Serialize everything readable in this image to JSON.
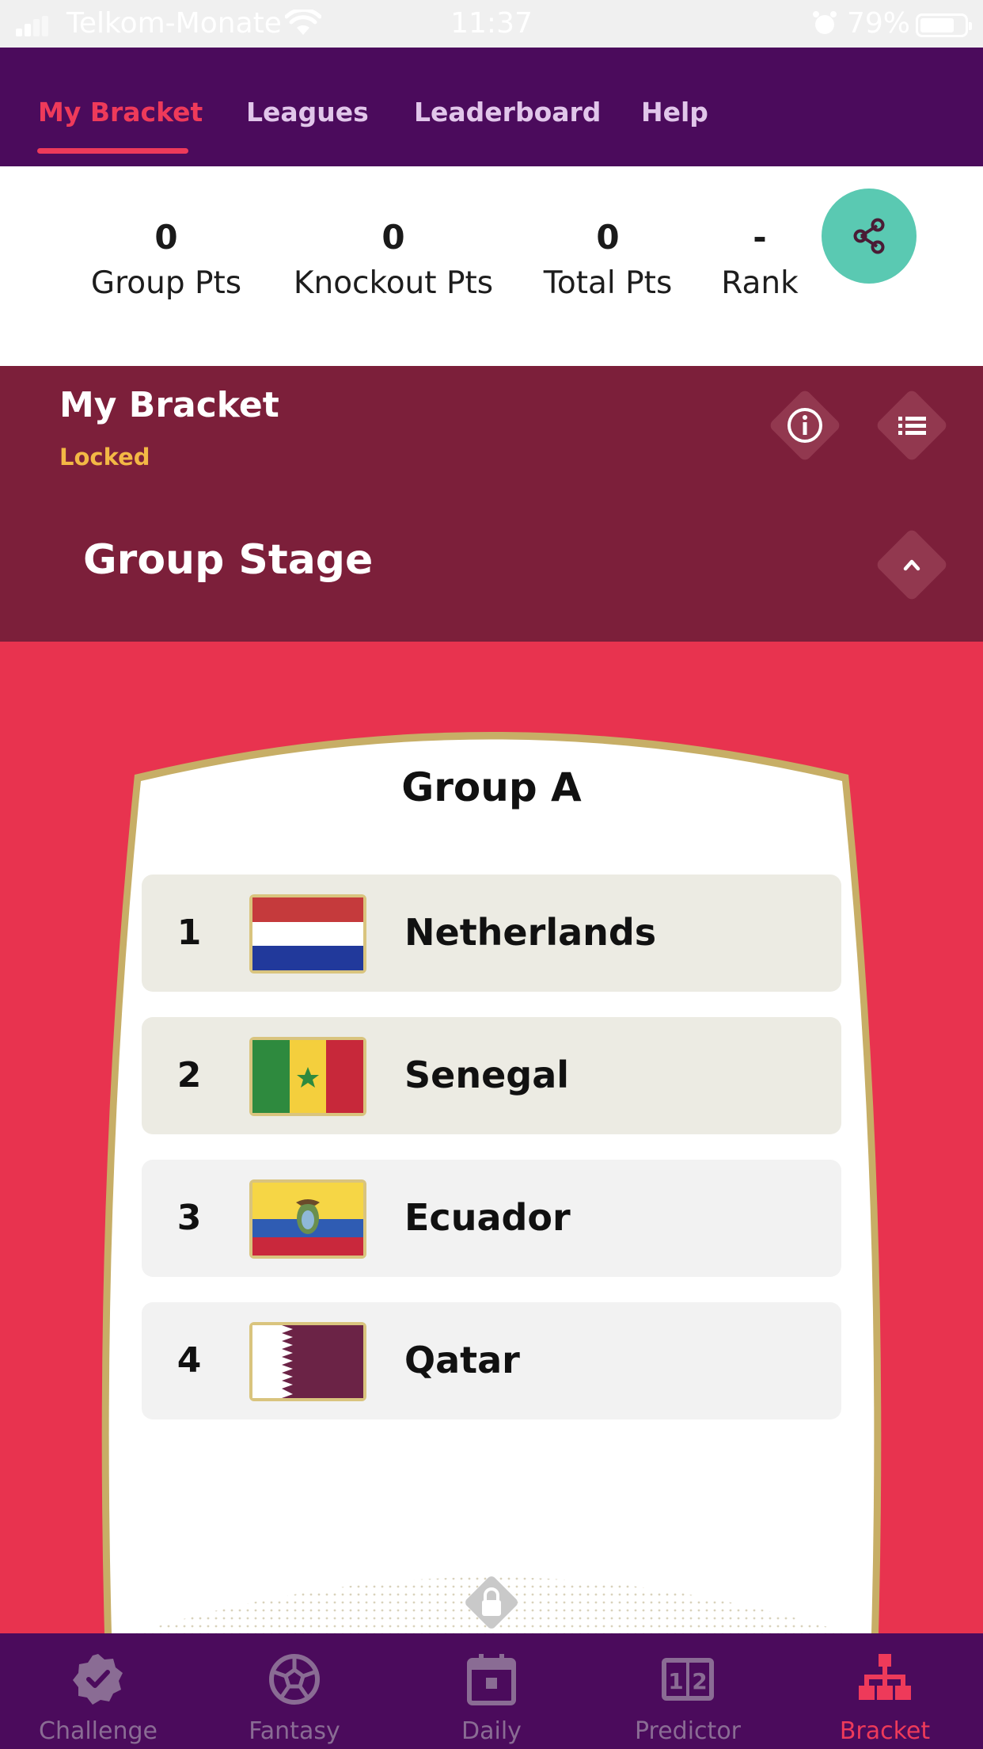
{
  "status_bar": {
    "carrier": "Telkom-Monate",
    "time": "11:37",
    "battery": "79%"
  },
  "top_tabs": [
    {
      "label": "My Bracket",
      "active": true
    },
    {
      "label": "Leagues",
      "active": false
    },
    {
      "label": "Leaderboard",
      "active": false
    },
    {
      "label": "Help",
      "active": false
    }
  ],
  "stats": [
    {
      "value": "0",
      "label": "Group Pts"
    },
    {
      "value": "0",
      "label": "Knockout Pts"
    },
    {
      "value": "0",
      "label": "Total Pts"
    },
    {
      "value": "-",
      "label": "Rank"
    }
  ],
  "bracket": {
    "title": "My Bracket",
    "status": "Locked"
  },
  "stage": {
    "title": "Group Stage"
  },
  "group": {
    "title": "Group A",
    "teams": [
      {
        "position": "1",
        "name": "Netherlands",
        "flag": "netherlands-flag"
      },
      {
        "position": "2",
        "name": "Senegal",
        "flag": "senegal-flag"
      },
      {
        "position": "3",
        "name": "Ecuador",
        "flag": "ecuador-flag"
      },
      {
        "position": "4",
        "name": "Qatar",
        "flag": "qatar-flag"
      }
    ]
  },
  "bottom_nav": [
    {
      "label": "Challenge",
      "icon": "verified-badge-icon",
      "active": false
    },
    {
      "label": "Fantasy",
      "icon": "soccer-ball-icon",
      "active": false
    },
    {
      "label": "Daily",
      "icon": "calendar-icon",
      "active": false
    },
    {
      "label": "Predictor",
      "icon": "scoreboard-icon",
      "active": false
    },
    {
      "label": "Bracket",
      "icon": "bracket-tree-icon",
      "active": true
    }
  ],
  "colors": {
    "nav_purple": "#4b0b5c",
    "accent_red": "#ee3a5a",
    "maroon": "#7c1f3a",
    "share_teal": "#5ac9b2",
    "locked_yellow": "#f3b845",
    "background_red": "#e8334f"
  }
}
